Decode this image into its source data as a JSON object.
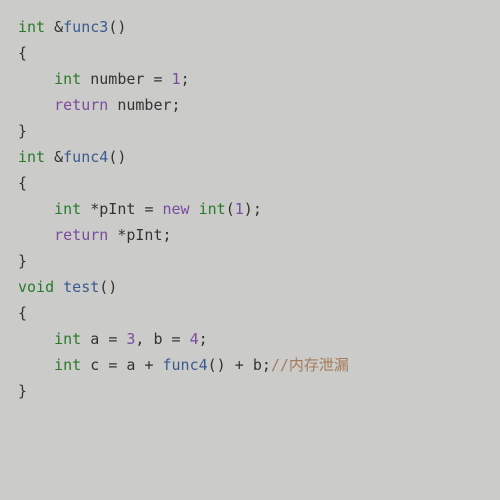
{
  "code": {
    "lines": [
      {
        "indent": 0,
        "tokens": [
          {
            "t": "int",
            "c": "type"
          },
          {
            "t": " ",
            "c": "sp"
          },
          {
            "t": "&",
            "c": "op"
          },
          {
            "t": "func3",
            "c": "func"
          },
          {
            "t": "()",
            "c": "punct"
          }
        ]
      },
      {
        "indent": 0,
        "tokens": [
          {
            "t": "{",
            "c": "punct"
          }
        ]
      },
      {
        "indent": 1,
        "tokens": [
          {
            "t": "int",
            "c": "type"
          },
          {
            "t": " ",
            "c": "sp"
          },
          {
            "t": "number",
            "c": "ident"
          },
          {
            "t": " ",
            "c": "sp"
          },
          {
            "t": "=",
            "c": "op"
          },
          {
            "t": " ",
            "c": "sp"
          },
          {
            "t": "1",
            "c": "num"
          },
          {
            "t": ";",
            "c": "op"
          }
        ]
      },
      {
        "indent": 1,
        "tokens": [
          {
            "t": "return",
            "c": "kw"
          },
          {
            "t": " ",
            "c": "sp"
          },
          {
            "t": "number",
            "c": "ident"
          },
          {
            "t": ";",
            "c": "op"
          }
        ]
      },
      {
        "indent": 0,
        "tokens": [
          {
            "t": "}",
            "c": "punct"
          }
        ]
      },
      {
        "indent": 0,
        "tokens": []
      },
      {
        "indent": 0,
        "tokens": [
          {
            "t": "int",
            "c": "type"
          },
          {
            "t": " ",
            "c": "sp"
          },
          {
            "t": "&",
            "c": "op"
          },
          {
            "t": "func4",
            "c": "func"
          },
          {
            "t": "()",
            "c": "punct"
          }
        ]
      },
      {
        "indent": 0,
        "tokens": [
          {
            "t": "{",
            "c": "punct"
          }
        ]
      },
      {
        "indent": 1,
        "tokens": [
          {
            "t": "int",
            "c": "type"
          },
          {
            "t": " ",
            "c": "sp"
          },
          {
            "t": "*",
            "c": "op"
          },
          {
            "t": "pInt",
            "c": "ident"
          },
          {
            "t": " ",
            "c": "sp"
          },
          {
            "t": "=",
            "c": "op"
          },
          {
            "t": " ",
            "c": "sp"
          },
          {
            "t": "new",
            "c": "kw"
          },
          {
            "t": " ",
            "c": "sp"
          },
          {
            "t": "int",
            "c": "type"
          },
          {
            "t": "(",
            "c": "punct"
          },
          {
            "t": "1",
            "c": "num"
          },
          {
            "t": ")",
            "c": "punct"
          },
          {
            "t": ";",
            "c": "op"
          }
        ]
      },
      {
        "indent": 1,
        "tokens": [
          {
            "t": "return",
            "c": "kw"
          },
          {
            "t": " ",
            "c": "sp"
          },
          {
            "t": "*",
            "c": "op"
          },
          {
            "t": "pInt",
            "c": "ident"
          },
          {
            "t": ";",
            "c": "op"
          }
        ]
      },
      {
        "indent": 0,
        "tokens": [
          {
            "t": "}",
            "c": "punct"
          }
        ]
      },
      {
        "indent": 0,
        "tokens": []
      },
      {
        "indent": 0,
        "tokens": [
          {
            "t": "void",
            "c": "type"
          },
          {
            "t": " ",
            "c": "sp"
          },
          {
            "t": "test",
            "c": "func"
          },
          {
            "t": "()",
            "c": "punct"
          }
        ]
      },
      {
        "indent": 0,
        "tokens": [
          {
            "t": "{",
            "c": "punct"
          }
        ]
      },
      {
        "indent": 1,
        "tokens": [
          {
            "t": "int",
            "c": "type"
          },
          {
            "t": " ",
            "c": "sp"
          },
          {
            "t": "a",
            "c": "ident"
          },
          {
            "t": " ",
            "c": "sp"
          },
          {
            "t": "=",
            "c": "op"
          },
          {
            "t": " ",
            "c": "sp"
          },
          {
            "t": "3",
            "c": "num"
          },
          {
            "t": ",",
            "c": "op"
          },
          {
            "t": " ",
            "c": "sp"
          },
          {
            "t": "b",
            "c": "ident"
          },
          {
            "t": " ",
            "c": "sp"
          },
          {
            "t": "=",
            "c": "op"
          },
          {
            "t": " ",
            "c": "sp"
          },
          {
            "t": "4",
            "c": "num"
          },
          {
            "t": ";",
            "c": "op"
          }
        ]
      },
      {
        "indent": 1,
        "tokens": [
          {
            "t": "int",
            "c": "type"
          },
          {
            "t": " ",
            "c": "sp"
          },
          {
            "t": "c",
            "c": "ident"
          },
          {
            "t": " ",
            "c": "sp"
          },
          {
            "t": "=",
            "c": "op"
          },
          {
            "t": " ",
            "c": "sp"
          },
          {
            "t": "a",
            "c": "ident"
          },
          {
            "t": " ",
            "c": "sp"
          },
          {
            "t": "+",
            "c": "op"
          },
          {
            "t": " ",
            "c": "sp"
          },
          {
            "t": "func4",
            "c": "func"
          },
          {
            "t": "()",
            "c": "punct"
          },
          {
            "t": " ",
            "c": "sp"
          },
          {
            "t": "+",
            "c": "op"
          },
          {
            "t": " ",
            "c": "sp"
          },
          {
            "t": "b",
            "c": "ident"
          },
          {
            "t": ";",
            "c": "op"
          },
          {
            "t": "//内存泄漏",
            "c": "comment"
          }
        ]
      },
      {
        "indent": 0,
        "tokens": [
          {
            "t": "}",
            "c": "punct"
          }
        ]
      }
    ],
    "indent_unit": "    "
  }
}
